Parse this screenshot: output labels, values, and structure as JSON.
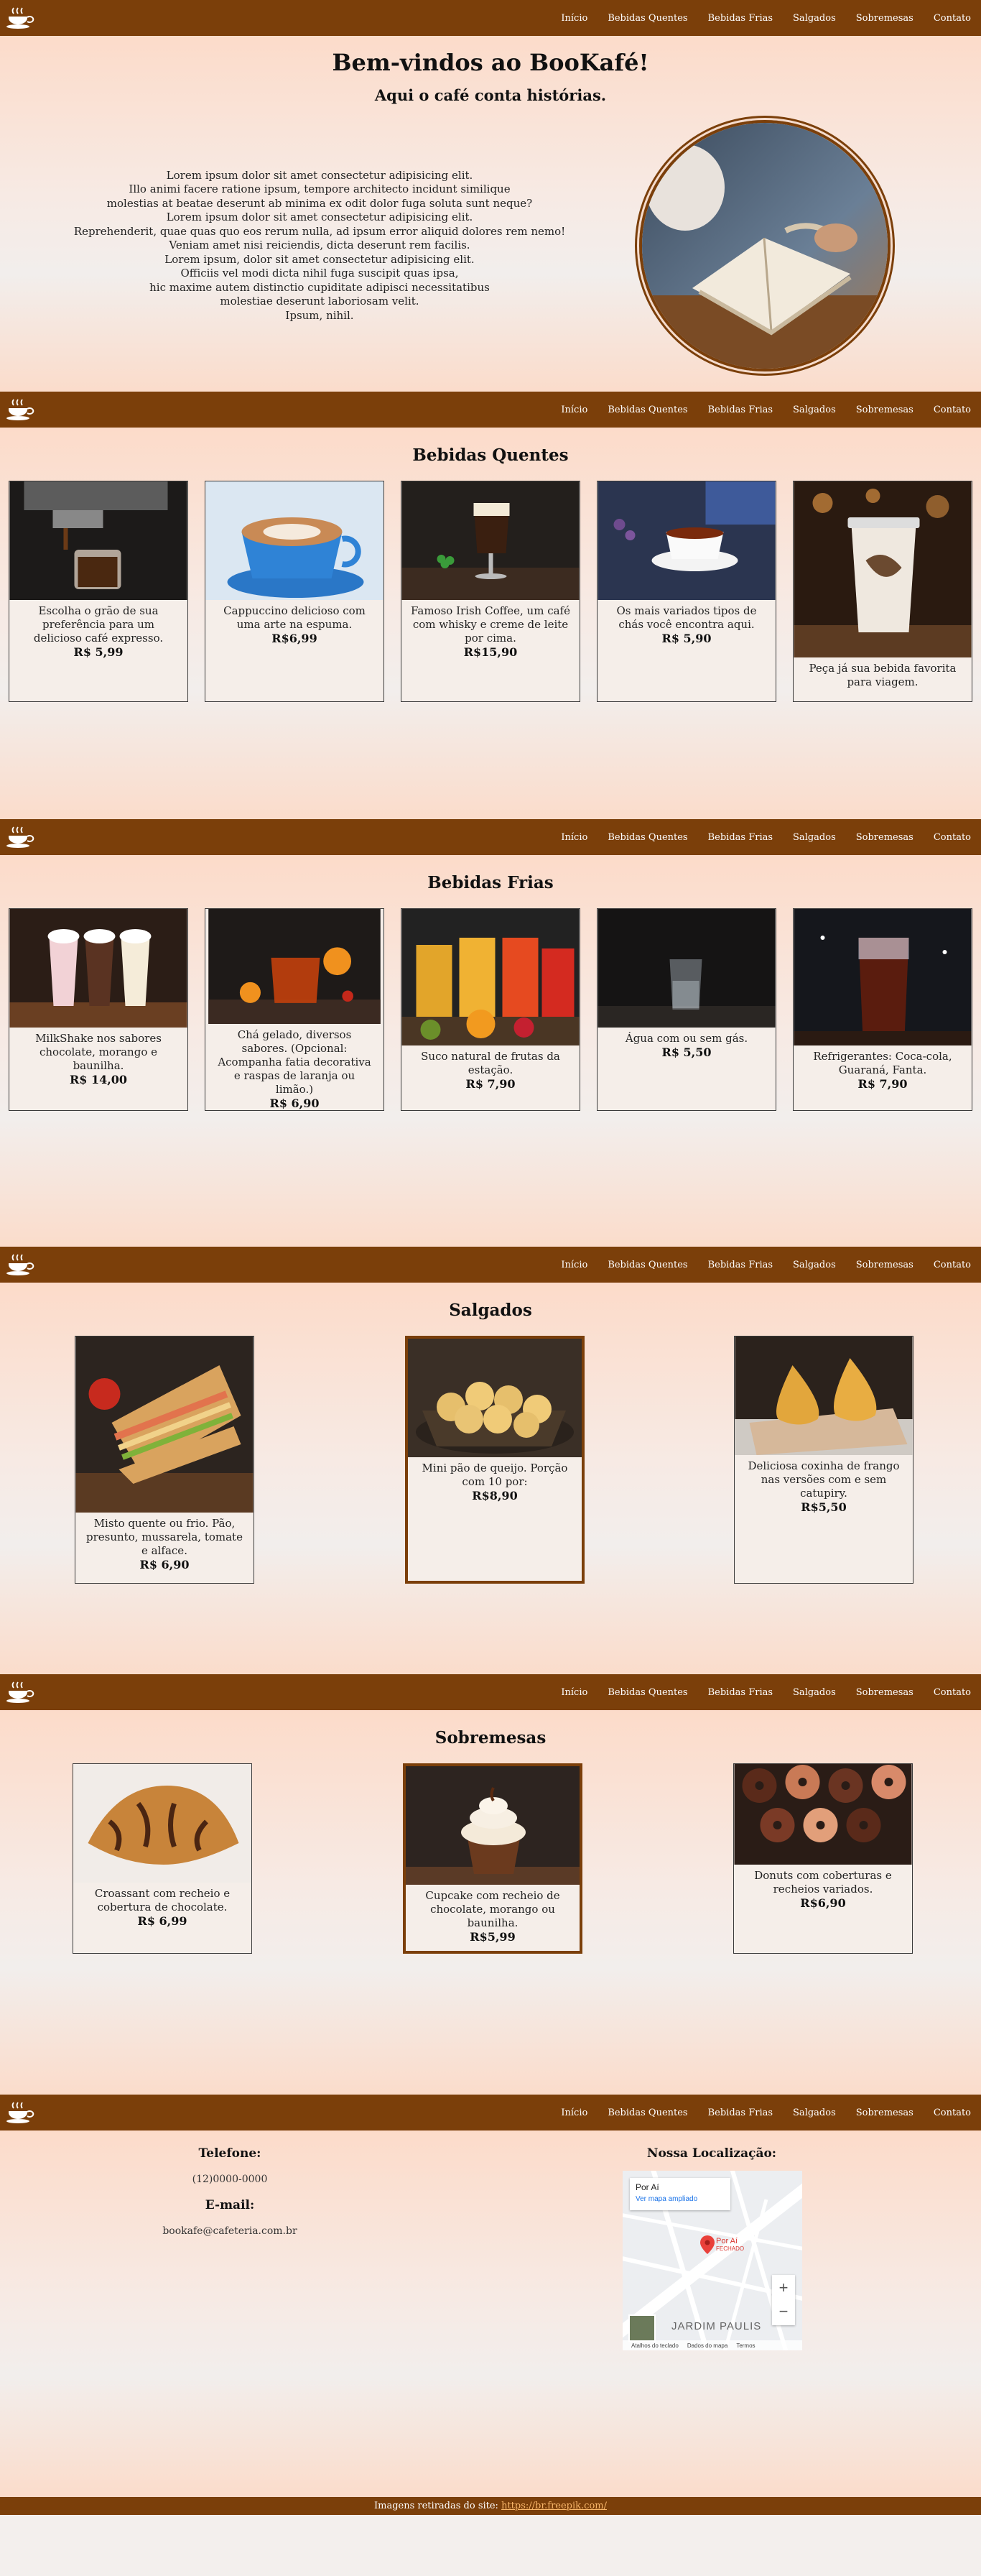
{
  "nav": {
    "items": [
      "Início",
      "Bebidas Quentes",
      "Bebidas Frias",
      "Salgados",
      "Sobremesas",
      "Contato"
    ]
  },
  "hero": {
    "title": "Bem-vindos ao BooKafé!",
    "subtitle": "Aqui o café conta histórias.",
    "lines": [
      "Lorem ipsum dolor sit amet consectetur adipisicing elit.",
      "Illo animi facere ratione ipsum, tempore architecto incidunt similique",
      "molestias at beatae deserunt ab minima ex odit dolor fuga soluta sunt neque?",
      "Lorem ipsum dolor sit amet consectetur adipisicing elit.",
      "Reprehenderit, quae quas quo eos rerum nulla, ad ipsum error aliquid dolores rem nemo!",
      "Veniam amet nisi reiciendis, dicta deserunt rem facilis.",
      "Lorem ipsum, dolor sit amet consectetur adipisicing elit.",
      "Officiis vel modi dicta nihil fuga suscipit quas ipsa,",
      "hic maxime autem distinctio cupiditate adipisci necessitatibus",
      "molestiae deserunt laboriosam velit.",
      "Ipsum, nihil."
    ]
  },
  "quentes": {
    "title": "Bebidas Quentes",
    "items": [
      {
        "desc": "Escolha o grão de sua preferência para um delicioso café expresso.",
        "price": "R$ 5,99"
      },
      {
        "desc": "Cappuccino delicioso com uma arte na espuma.",
        "price": "R$6,99"
      },
      {
        "desc": "Famoso Irish Coffee, um café com whisky e creme de leite por cima.",
        "price": "R$15,90"
      },
      {
        "desc": "Os mais variados tipos de chás você encontra aqui.",
        "price": "R$ 5,90"
      },
      {
        "desc": "Peça já sua bebida favorita para viagem.",
        "price": ""
      }
    ]
  },
  "frias": {
    "title": "Bebidas Frias",
    "items": [
      {
        "desc": "MilkShake nos sabores chocolate, morango e baunilha.",
        "price": "R$ 14,00"
      },
      {
        "desc": "Chá gelado, diversos sabores. (Opcional: Acompanha fatia decorativa e raspas de laranja ou limão.)",
        "price": "R$ 6,90"
      },
      {
        "desc": "Suco natural de frutas da estação.",
        "price": "R$ 7,90"
      },
      {
        "desc": "Água com ou sem gás.",
        "price": "R$ 5,50"
      },
      {
        "desc": "Refrigerantes: Coca-cola, Guaraná, Fanta.",
        "price": "R$ 7,90"
      }
    ]
  },
  "salgados": {
    "title": "Salgados",
    "items": [
      {
        "desc": "Misto quente ou frio. Pão, presunto, mussarela, tomate e alface.",
        "price": "R$ 6,90"
      },
      {
        "desc": "Mini pão de queijo. Porção com 10 por:",
        "price": "R$8,90"
      },
      {
        "desc": "Deliciosa coxinha de frango nas versões com e sem catupiry.",
        "price": "R$5,50"
      }
    ]
  },
  "sobremesas": {
    "title": "Sobremesas",
    "items": [
      {
        "desc": "Croassant com recheio e cobertura de chocolate.",
        "price": "R$ 6,99"
      },
      {
        "desc": "Cupcake com recheio de chocolate, morango ou baunilha.",
        "price": "R$5,99"
      },
      {
        "desc": "Donuts com coberturas e recheios variados.",
        "price": "R$6,90"
      }
    ]
  },
  "contato": {
    "phone_label": "Telefone:",
    "phone": "(12)0000-0000",
    "email_label": "E-mail:",
    "email": "bookafe@cafeteria.com.br",
    "map_title": "Nossa Localização:",
    "map": {
      "place": "Por Aí",
      "link": "Ver mapa ampliado",
      "pin_label": "Por Aí",
      "pin_status": "FECHADO",
      "district": "JARDIM PAULIS",
      "footer_items": [
        "Atalhos do teclado",
        "Dados do mapa",
        "Termos"
      ]
    }
  },
  "footer": {
    "text": "Imagens retiradas do site: ",
    "link": "https://br.freepik.com/"
  },
  "colors": {
    "brand": "#7b3f0a",
    "accent": "#f8b66a"
  }
}
